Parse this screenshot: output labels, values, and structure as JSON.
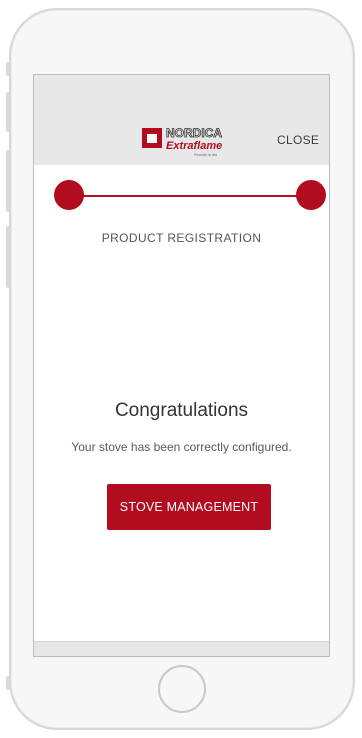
{
  "header": {
    "logo_text_top": "NORDICA",
    "logo_text_bottom": "Extraflame",
    "logo_tagline": "Pirosolto la vita",
    "close_label": "CLOSE"
  },
  "progress": {
    "steps_total": 2,
    "current_step": 2
  },
  "step_label": "PRODUCT REGISTRATION",
  "main": {
    "title": "Congratulations",
    "subtitle": "Your stove has been correctly configured.",
    "button_label": "STOVE MANAGEMENT"
  },
  "colors": {
    "accent": "#b10d1e",
    "header_bg": "#e8e8e8"
  }
}
